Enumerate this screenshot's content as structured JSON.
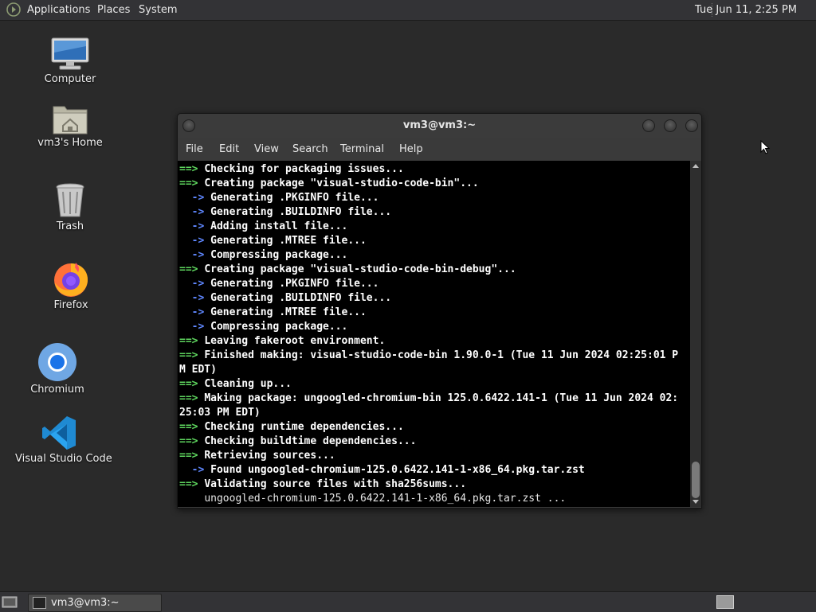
{
  "top_panel": {
    "menus": [
      "Applications",
      "Places",
      "System"
    ],
    "clock": "Tue Jun 11,  2:25 PM"
  },
  "desktop": {
    "icons": [
      {
        "label": "Computer",
        "icon": "computer-icon"
      },
      {
        "label": "vm3's Home",
        "icon": "home-folder-icon"
      },
      {
        "label": "Trash",
        "icon": "trash-icon"
      },
      {
        "label": "Firefox",
        "icon": "firefox-icon"
      },
      {
        "label": "Chromium",
        "icon": "chromium-icon"
      },
      {
        "label": "Visual Studio Code",
        "icon": "vscode-icon"
      }
    ]
  },
  "terminal": {
    "title": "vm3@vm3:~",
    "menus": [
      "File",
      "Edit",
      "View",
      "Search",
      "Terminal",
      "Help"
    ],
    "lines": [
      {
        "prefix": "==> ",
        "kind": "green",
        "text": "Checking for packaging issues..."
      },
      {
        "prefix": "==> ",
        "kind": "green",
        "text": "Creating package \"visual-studio-code-bin\"..."
      },
      {
        "prefix": "  -> ",
        "kind": "blue",
        "text": "Generating .PKGINFO file..."
      },
      {
        "prefix": "  -> ",
        "kind": "blue",
        "text": "Generating .BUILDINFO file..."
      },
      {
        "prefix": "  -> ",
        "kind": "blue",
        "text": "Adding install file..."
      },
      {
        "prefix": "  -> ",
        "kind": "blue",
        "text": "Generating .MTREE file..."
      },
      {
        "prefix": "  -> ",
        "kind": "blue",
        "text": "Compressing package..."
      },
      {
        "prefix": "==> ",
        "kind": "green",
        "text": "Creating package \"visual-studio-code-bin-debug\"..."
      },
      {
        "prefix": "  -> ",
        "kind": "blue",
        "text": "Generating .PKGINFO file..."
      },
      {
        "prefix": "  -> ",
        "kind": "blue",
        "text": "Generating .BUILDINFO file..."
      },
      {
        "prefix": "  -> ",
        "kind": "blue",
        "text": "Generating .MTREE file..."
      },
      {
        "prefix": "  -> ",
        "kind": "blue",
        "text": "Compressing package..."
      },
      {
        "prefix": "==> ",
        "kind": "green",
        "text": "Leaving fakeroot environment."
      },
      {
        "prefix": "==> ",
        "kind": "green",
        "text": "Finished making: visual-studio-code-bin 1.90.0-1 (Tue 11 Jun 2024 02:25:01 P"
      },
      {
        "prefix": "",
        "kind": "none",
        "text": "M EDT)"
      },
      {
        "prefix": "==> ",
        "kind": "green",
        "text": "Cleaning up..."
      },
      {
        "prefix": "==> ",
        "kind": "green",
        "text": "Making package: ungoogled-chromium-bin 125.0.6422.141-1 (Tue 11 Jun 2024 02:"
      },
      {
        "prefix": "",
        "kind": "none",
        "text": "25:03 PM EDT)"
      },
      {
        "prefix": "==> ",
        "kind": "green",
        "text": "Checking runtime dependencies..."
      },
      {
        "prefix": "==> ",
        "kind": "green",
        "text": "Checking buildtime dependencies..."
      },
      {
        "prefix": "==> ",
        "kind": "green",
        "text": "Retrieving sources..."
      },
      {
        "prefix": "  -> ",
        "kind": "blue",
        "text": "Found ungoogled-chromium-125.0.6422.141-1-x86_64.pkg.tar.zst"
      },
      {
        "prefix": "==> ",
        "kind": "green",
        "text": "Validating source files with sha256sums..."
      },
      {
        "prefix": "    ",
        "kind": "plain",
        "text": "ungoogled-chromium-125.0.6422.141-1-x86_64.pkg.tar.zst ..."
      }
    ]
  },
  "taskbar": {
    "task_label": "vm3@vm3:~"
  }
}
